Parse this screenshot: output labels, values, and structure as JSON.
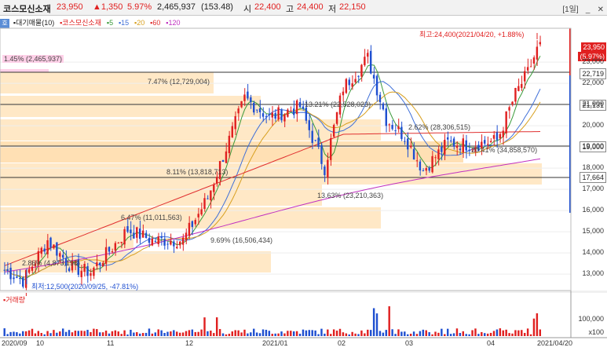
{
  "header": {
    "name": "코스모신소재",
    "price": "23,950",
    "change": "▲1,350",
    "change_pct": "5.97%",
    "volume": "2,465,937",
    "volume_ratio": "(153.48)",
    "open_label": "시",
    "open": "22,400",
    "high_label": "고",
    "high": "24,400",
    "low_label": "저",
    "low": "22,150",
    "period_button": "[1일]",
    "colors": {
      "up": "#e02020",
      "down": "#1f4fd0"
    }
  },
  "legend": {
    "home_icon": "호",
    "supply_label": "대기매물(10)",
    "stock_label": "코스모신소재",
    "ma": [
      {
        "label": "5",
        "color": "#3a9a3a"
      },
      {
        "label": "15",
        "color": "#3f6fd8"
      },
      {
        "label": "20",
        "color": "#d8a020"
      },
      {
        "label": "60",
        "color": "#e03030"
      },
      {
        "label": "120",
        "color": "#c030c0"
      }
    ]
  },
  "annotations": {
    "high": "최고:24,400(2021/04/20, +1.88%)",
    "low": "최저:12,500(2020/09/25, -47.81%)",
    "cur_price_tag": "23,950",
    "cur_pct_tag": "(5.97%)",
    "level_tags": [
      "22,719",
      "21,131",
      "19,000",
      "17,664"
    ],
    "supply_bands": [
      {
        "text": "1.45% (2,465,937)"
      },
      {
        "text": "7.47% (12,729,004)"
      },
      {
        "text": "13.21% (22,528,023)"
      },
      {
        "text": "2.62% (28,306,515)"
      },
      {
        "text": "20.41% (34,858,570)"
      },
      {
        "text": "8.11% (13,818,713)"
      },
      {
        "text": "13.63% (23,210,363)"
      },
      {
        "text": "6.47% (11,011,563)"
      },
      {
        "text": "9.69% (16,506,434)"
      },
      {
        "text": "2.86% (4,873,198)"
      }
    ]
  },
  "y_ticks": [
    "23,000",
    "22,000",
    "21,000",
    "20,000",
    "19,000",
    "18,000",
    "17,000",
    "16,000",
    "15,000",
    "14,000",
    "13,000"
  ],
  "volume_panel": {
    "label": "거래량",
    "tick": "100,000",
    "unit": "x100"
  },
  "x_labels": [
    "2020/09",
    "10",
    "11",
    "12",
    "2021/01",
    "02",
    "03",
    "04",
    "2021/04/20"
  ],
  "chart_data": {
    "type": "candlestick",
    "ylim": [
      12300,
      24600
    ],
    "start_close": 13200,
    "n_candles": 140
  }
}
